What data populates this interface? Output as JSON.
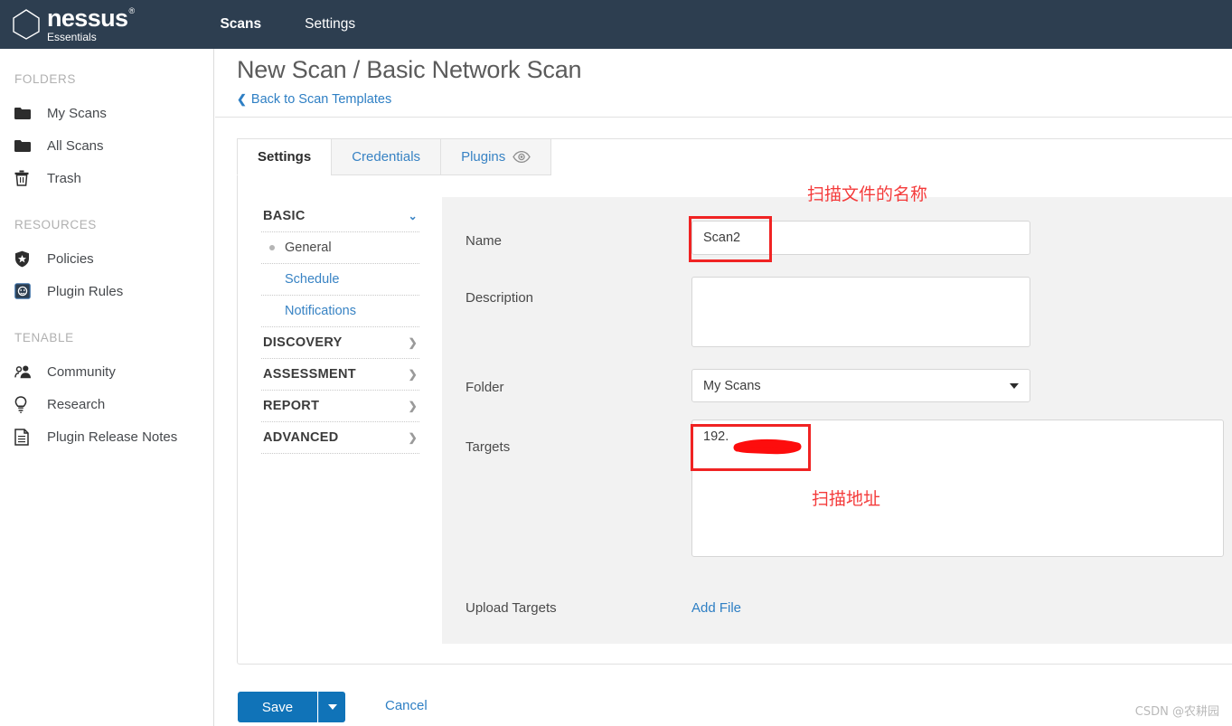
{
  "brand": {
    "name": "nessus",
    "trademark": "®",
    "edition": "Essentials",
    "logo_icon": "hexagon-outline-icon"
  },
  "topnav": {
    "items": [
      {
        "label": "Scans",
        "active": true
      },
      {
        "label": "Settings",
        "active": false
      }
    ]
  },
  "sidebar": {
    "groups": [
      {
        "title": "FOLDERS",
        "items": [
          {
            "label": "My Scans",
            "icon": "folder-icon"
          },
          {
            "label": "All Scans",
            "icon": "folder-icon"
          },
          {
            "label": "Trash",
            "icon": "trash-icon"
          }
        ]
      },
      {
        "title": "RESOURCES",
        "items": [
          {
            "label": "Policies",
            "icon": "shield-star-icon"
          },
          {
            "label": "Plugin Rules",
            "icon": "plugin-badge-icon"
          }
        ]
      },
      {
        "title": "TENABLE",
        "items": [
          {
            "label": "Community",
            "icon": "users-icon"
          },
          {
            "label": "Research",
            "icon": "lightbulb-icon"
          },
          {
            "label": "Plugin Release Notes",
            "icon": "document-icon"
          }
        ]
      }
    ]
  },
  "page": {
    "title": "New Scan / Basic Network Scan",
    "back_link": "Back to Scan Templates",
    "back_icon": "chevron-left-icon"
  },
  "tabs": [
    {
      "label": "Settings",
      "active": true,
      "icon": null
    },
    {
      "label": "Credentials",
      "active": false,
      "icon": null
    },
    {
      "label": "Plugins",
      "active": false,
      "icon": "eye-icon"
    }
  ],
  "submenu": [
    {
      "label": "BASIC",
      "type": "header",
      "expanded": true,
      "icon": "chevron-down-icon"
    },
    {
      "label": "General",
      "type": "item",
      "selected": true
    },
    {
      "label": "Schedule",
      "type": "item",
      "selected": false
    },
    {
      "label": "Notifications",
      "type": "item",
      "selected": false
    },
    {
      "label": "DISCOVERY",
      "type": "header",
      "expanded": false,
      "icon": "chevron-right-icon"
    },
    {
      "label": "ASSESSMENT",
      "type": "header",
      "expanded": false,
      "icon": "chevron-right-icon"
    },
    {
      "label": "REPORT",
      "type": "header",
      "expanded": false,
      "icon": "chevron-right-icon"
    },
    {
      "label": "ADVANCED",
      "type": "header",
      "expanded": false,
      "icon": "chevron-right-icon"
    }
  ],
  "form": {
    "name": {
      "label": "Name",
      "value": "Scan2",
      "placeholder": ""
    },
    "description": {
      "label": "Description",
      "value": "",
      "placeholder": ""
    },
    "folder": {
      "label": "Folder",
      "value": "My Scans",
      "options": [
        "My Scans"
      ],
      "caret_icon": "caret-down-icon"
    },
    "targets": {
      "label": "Targets",
      "value": "192.",
      "placeholder": ""
    },
    "upload_targets": {
      "label": "Upload Targets",
      "link": "Add File"
    }
  },
  "annotations": [
    {
      "text": "扫描文件的名称",
      "target": "name-field"
    },
    {
      "text": "扫描地址",
      "target": "targets-field"
    }
  ],
  "footer": {
    "save_label": "Save",
    "save_caret_icon": "caret-down-icon",
    "cancel_label": "Cancel"
  },
  "watermark": "CSDN @农耕园",
  "colors": {
    "header_bg": "#2d3e50",
    "accent_blue": "#2e7fc4",
    "button_blue": "#1073b8",
    "annotation_red": "#f43b3b",
    "form_bg": "#f2f2f2"
  }
}
